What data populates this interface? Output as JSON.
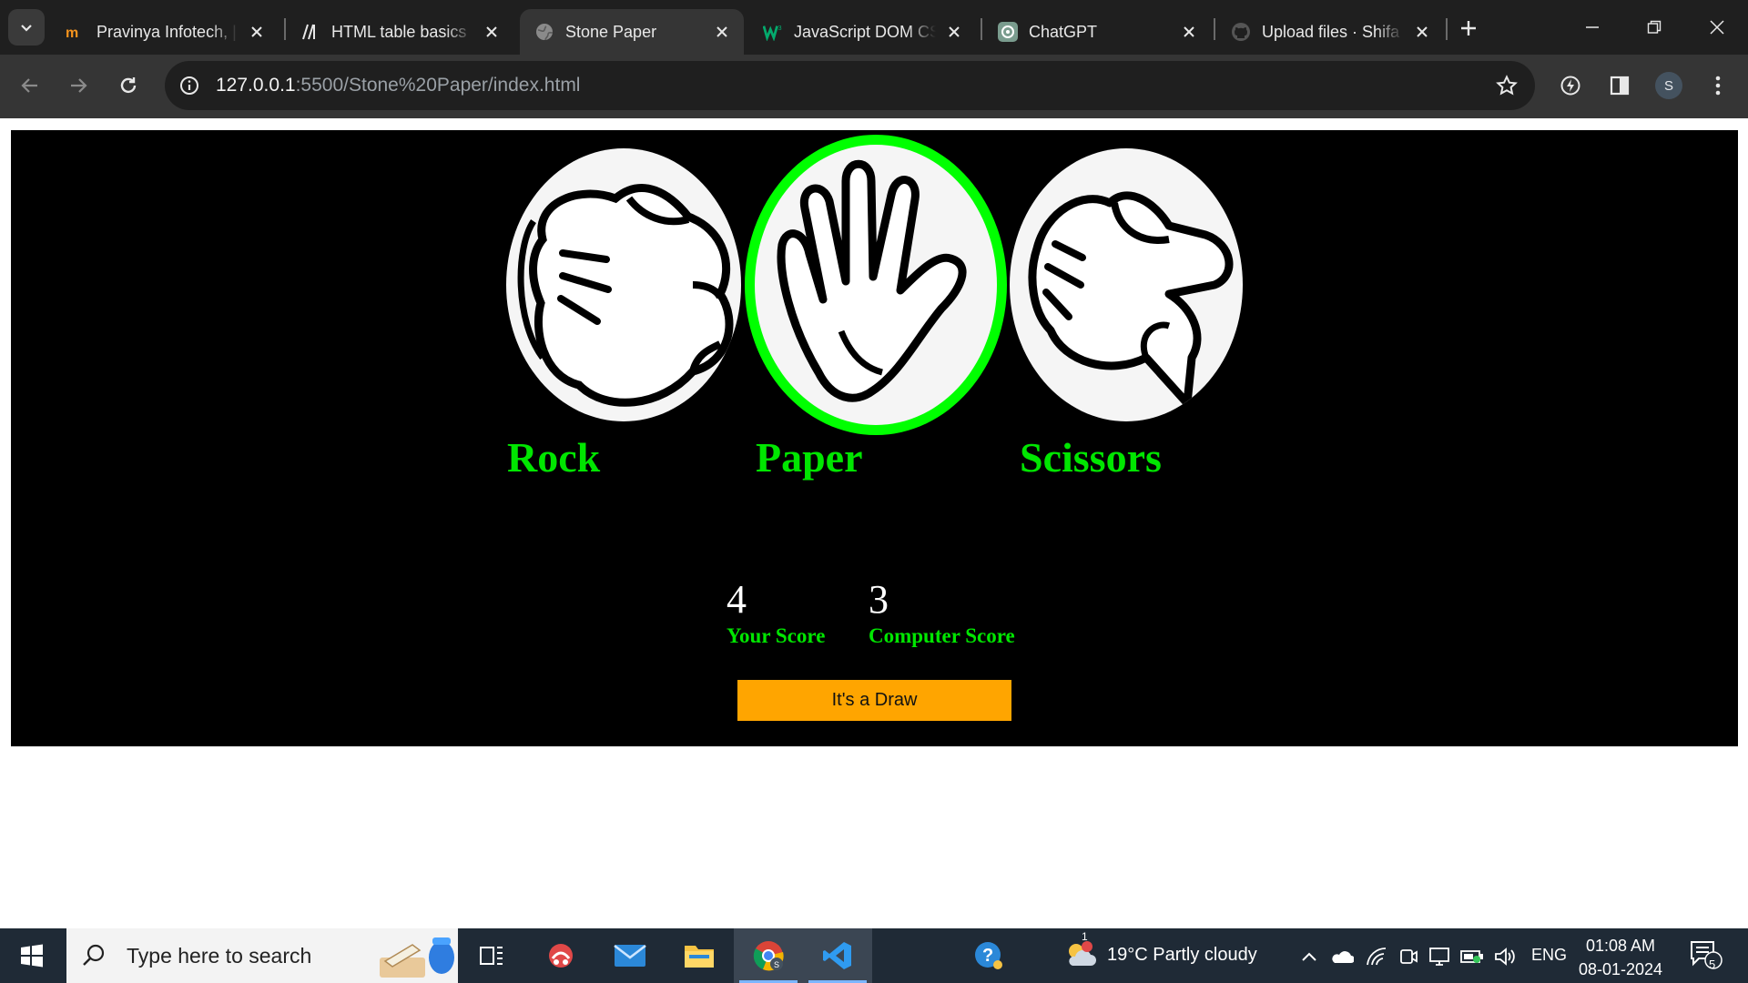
{
  "browser": {
    "tabs": [
      {
        "title": "Pravinya Infotech, |",
        "favicon": "pravinya-icon"
      },
      {
        "title": "HTML table basics",
        "favicon": "mdn-icon"
      },
      {
        "title": "Stone Paper",
        "favicon": "globe-icon",
        "active": true
      },
      {
        "title": "JavaScript DOM CS",
        "favicon": "w3-icon"
      },
      {
        "title": "ChatGPT",
        "favicon": "chatgpt-icon"
      },
      {
        "title": "Upload files · Shifa",
        "favicon": "github-icon"
      }
    ],
    "url_host": "127.0.0.1",
    "url_path": ":5500/Stone%20Paper/index.html",
    "profile_initial": "S"
  },
  "game": {
    "choices": [
      {
        "label": "Rock",
        "icon": "rock-hand-icon",
        "selected": false
      },
      {
        "label": "Paper",
        "icon": "paper-hand-icon",
        "selected": true
      },
      {
        "label": "Scissors",
        "icon": "scissors-hand-icon",
        "selected": false
      }
    ],
    "your_score": "4",
    "your_score_label": "Your Score",
    "computer_score": "3",
    "computer_score_label": "Computer Score",
    "result_message": "It's a Draw"
  },
  "taskbar": {
    "search_placeholder": "Type here to search",
    "weather": "19°C  Partly cloudy",
    "weather_badge": "1",
    "language": "ENG",
    "time": "01:08 AM",
    "date": "08-01-2024",
    "notifications": "5",
    "accent": "#7cb6ff"
  },
  "colors": {
    "label_green": "#00e600",
    "selected_ring": "#00ff00",
    "result_bg": "#ffa500"
  }
}
